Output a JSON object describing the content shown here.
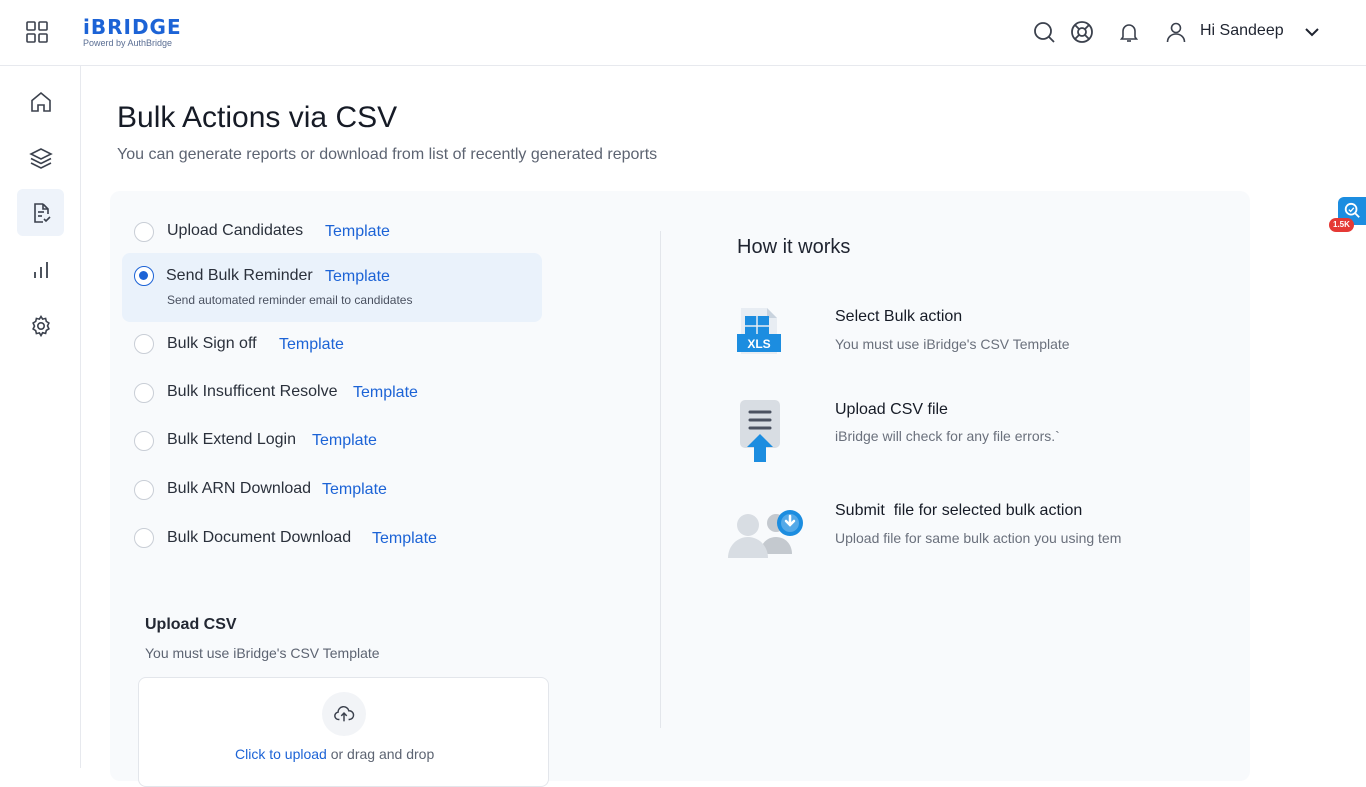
{
  "header": {
    "logo_main": "iBRIDGE",
    "logo_sub": "Powerd by AuthBridge",
    "greeting": "Hi Sandeep",
    "icons": [
      "apps-grid-icon",
      "search-icon",
      "support-icon",
      "bell-icon",
      "user-icon",
      "chevron-down-icon"
    ]
  },
  "sidebar": {
    "items": [
      {
        "name": "home",
        "icon": "home-icon",
        "active": false
      },
      {
        "name": "layers",
        "icon": "layers-icon",
        "active": false
      },
      {
        "name": "reports",
        "icon": "document-check-icon",
        "active": true
      },
      {
        "name": "analytics",
        "icon": "bar-chart-icon",
        "active": false
      },
      {
        "name": "settings",
        "icon": "gear-icon",
        "active": false
      }
    ]
  },
  "page": {
    "title": "Bulk Actions via CSV",
    "subtitle": "You can generate reports or download from list of recently generated reports"
  },
  "options": [
    {
      "label": "Upload Candidates",
      "link": "Template",
      "selected": false
    },
    {
      "label": "Send Bulk Reminder",
      "link": "Template",
      "selected": true,
      "description": "Send automated reminder email to candidates"
    },
    {
      "label": "Bulk Sign off",
      "link": "Template",
      "selected": false
    },
    {
      "label": "Bulk Insufficent Resolve",
      "link": "Template",
      "selected": false
    },
    {
      "label": "Bulk Extend Login",
      "link": "Template",
      "selected": false
    },
    {
      "label": "Bulk ARN Download",
      "link": "Template",
      "selected": false
    },
    {
      "label": "Bulk Document Download",
      "link": "Template",
      "selected": false
    }
  ],
  "upload": {
    "title": "Upload CSV",
    "subtitle": "You must use iBridge's CSV Template",
    "click_text": "Click to upload",
    "drag_text": " or drag and drop"
  },
  "how_it_works": {
    "title": "How it works",
    "steps": [
      {
        "title": "Select Bulk action",
        "description": "You must use iBridge's CSV Template",
        "icon": "xls-file-icon",
        "icon_text": "XLS"
      },
      {
        "title": "Upload CSV file",
        "description": "iBridge will check for any file errors.`",
        "icon": "file-upload-icon"
      },
      {
        "title": "Submit  file for selected bulk action",
        "description": "Upload file for same bulk action you using tem",
        "icon": "users-download-icon"
      }
    ]
  },
  "widget": {
    "badge": "1.5K",
    "icon": "zoom-search-icon"
  },
  "colors": {
    "accent": "#1c63d6",
    "card_bg": "#f8fafc",
    "selected_bg": "#eaf2fb"
  }
}
